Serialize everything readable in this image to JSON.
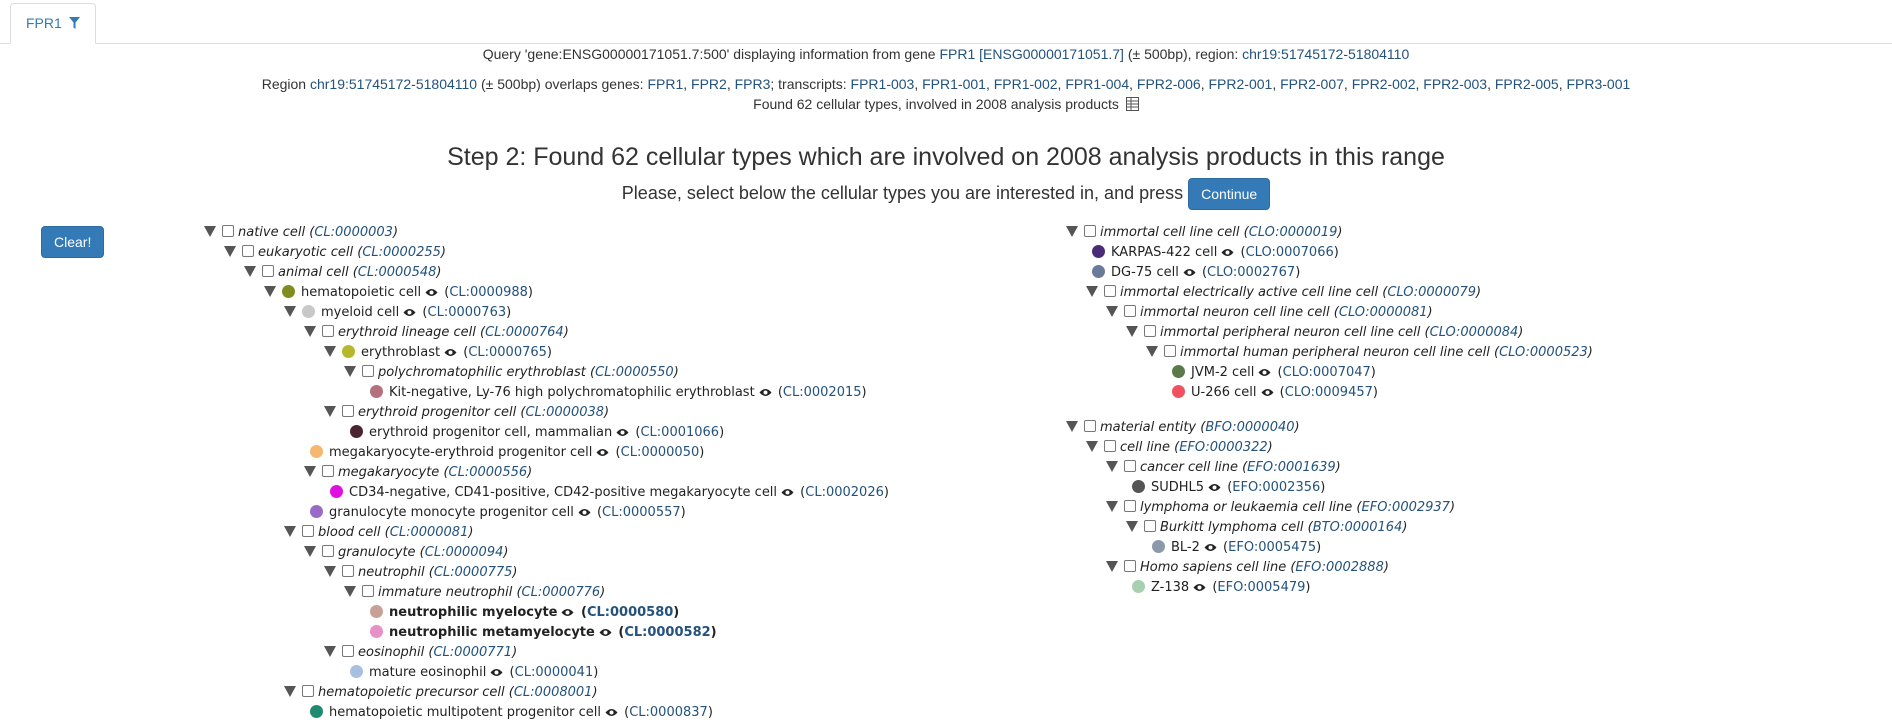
{
  "tab": {
    "label": "FPR1"
  },
  "query_line": {
    "prefix": "Query 'gene:ENSG00000171051.7:500' displaying information from gene ",
    "gene_link": "FPR1 [ENSG00000171051.7]",
    "middle": " (± 500bp), region: ",
    "region_link": "chr19:51745172-51804110"
  },
  "region_line": {
    "prefix": "Region ",
    "region_link": "chr19:51745172-51804110",
    "middle": " (± 500bp) overlaps genes: ",
    "genes": [
      "FPR1",
      "FPR2",
      "FPR3"
    ],
    "transcripts_label": "; transcripts: ",
    "transcripts": [
      "FPR1-003",
      "FPR1-001",
      "FPR1-002",
      "FPR1-004",
      "FPR2-006",
      "FPR2-001",
      "FPR2-007",
      "FPR2-002",
      "FPR2-003",
      "FPR2-005",
      "FPR3-001"
    ]
  },
  "found_line": "Found 62 cellular types, involved in 2008 analysis products",
  "step_title": "Step 2: Found 62 cellular types which are involved on 2008 analysis products in this range",
  "select_text": "Please, select below the cellular types you are interested in, and press",
  "continue_label": "Continue",
  "clear_label": "Clear!",
  "left_tree": [
    {
      "depth": 0,
      "kind": "group",
      "label": "native cell",
      "id": "CL:0000003"
    },
    {
      "depth": 1,
      "kind": "group",
      "label": "eukaryotic cell",
      "id": "CL:0000255"
    },
    {
      "depth": 2,
      "kind": "group",
      "label": "animal cell",
      "id": "CL:0000548"
    },
    {
      "depth": 3,
      "kind": "node",
      "color": "#7f8c1f",
      "label": "hematopoietic cell",
      "id": "CL:0000988"
    },
    {
      "depth": 4,
      "kind": "node",
      "color": "#c8c8c8",
      "label": "myeloid cell",
      "id": "CL:0000763"
    },
    {
      "depth": 5,
      "kind": "group",
      "label": "erythroid lineage cell",
      "id": "CL:0000764"
    },
    {
      "depth": 6,
      "kind": "node",
      "color": "#b5b82a",
      "label": "erythroblast",
      "id": "CL:0000765"
    },
    {
      "depth": 7,
      "kind": "group",
      "label": "polychromatophilic erythroblast",
      "id": "CL:0000550"
    },
    {
      "depth": 8,
      "kind": "leaf",
      "color": "#b5707e",
      "label": "Kit-negative, Ly-76 high polychromatophilic erythroblast",
      "id": "CL:0002015"
    },
    {
      "depth": 6,
      "kind": "group",
      "label": "erythroid progenitor cell",
      "id": "CL:0000038"
    },
    {
      "depth": 7,
      "kind": "leaf",
      "color": "#4a2530",
      "label": "erythroid progenitor cell, mammalian",
      "id": "CL:0001066"
    },
    {
      "depth": 5,
      "kind": "leaf",
      "color": "#f5b870",
      "label": "megakaryocyte-erythroid progenitor cell",
      "id": "CL:0000050"
    },
    {
      "depth": 5,
      "kind": "group",
      "label": "megakaryocyte",
      "id": "CL:0000556"
    },
    {
      "depth": 6,
      "kind": "leaf",
      "color": "#e010e0",
      "label": "CD34-negative, CD41-positive, CD42-positive megakaryocyte cell",
      "id": "CL:0002026"
    },
    {
      "depth": 5,
      "kind": "leaf",
      "color": "#9a6ac8",
      "label": "granulocyte monocyte progenitor cell",
      "id": "CL:0000557"
    },
    {
      "depth": 4,
      "kind": "group",
      "label": "blood cell",
      "id": "CL:0000081"
    },
    {
      "depth": 5,
      "kind": "group",
      "label": "granulocyte",
      "id": "CL:0000094"
    },
    {
      "depth": 6,
      "kind": "group",
      "label": "neutrophil",
      "id": "CL:0000775"
    },
    {
      "depth": 7,
      "kind": "group",
      "label": "immature neutrophil",
      "id": "CL:0000776"
    },
    {
      "depth": 8,
      "kind": "leaf",
      "color": "#c8a096",
      "label": "neutrophilic myelocyte",
      "id": "CL:0000580",
      "bold": true
    },
    {
      "depth": 8,
      "kind": "leaf",
      "color": "#e890c8",
      "label": "neutrophilic metamyelocyte",
      "id": "CL:0000582",
      "bold": true
    },
    {
      "depth": 6,
      "kind": "group",
      "label": "eosinophil",
      "id": "CL:0000771"
    },
    {
      "depth": 7,
      "kind": "leaf",
      "color": "#a8c0e0",
      "label": "mature eosinophil",
      "id": "CL:0000041"
    },
    {
      "depth": 4,
      "kind": "group",
      "label": "hematopoietic precursor cell",
      "id": "CL:0008001"
    },
    {
      "depth": 5,
      "kind": "leaf",
      "color": "#1f8a70",
      "label": "hematopoietic multipotent progenitor cell",
      "id": "CL:0000837"
    }
  ],
  "right_tree_a": [
    {
      "depth": 0,
      "kind": "group",
      "label": "immortal cell line cell",
      "id": "CLO:0000019"
    },
    {
      "depth": 1,
      "kind": "leaf",
      "color": "#4b2a7a",
      "label": "KARPAS-422 cell",
      "id": "CLO:0007066"
    },
    {
      "depth": 1,
      "kind": "leaf",
      "color": "#6a7a9a",
      "label": "DG-75 cell",
      "id": "CLO:0002767"
    },
    {
      "depth": 1,
      "kind": "group",
      "label": "immortal electrically active cell line cell",
      "id": "CLO:0000079"
    },
    {
      "depth": 2,
      "kind": "group",
      "label": "immortal neuron cell line cell",
      "id": "CLO:0000081"
    },
    {
      "depth": 3,
      "kind": "group",
      "label": "immortal peripheral neuron cell line cell",
      "id": "CLO:0000084"
    },
    {
      "depth": 4,
      "kind": "group",
      "label": "immortal human peripheral neuron cell line cell",
      "id": "CLO:0000523"
    },
    {
      "depth": 5,
      "kind": "leaf",
      "color": "#5a7a4a",
      "label": "JVM-2 cell",
      "id": "CLO:0007047"
    },
    {
      "depth": 5,
      "kind": "leaf",
      "color": "#f05060",
      "label": "U-266 cell",
      "id": "CLO:0009457"
    }
  ],
  "right_tree_b": [
    {
      "depth": 0,
      "kind": "group",
      "label": "material entity",
      "id": "BFO:0000040"
    },
    {
      "depth": 1,
      "kind": "group",
      "label": "cell line",
      "id": "EFO:0000322"
    },
    {
      "depth": 2,
      "kind": "group",
      "label": "cancer cell line",
      "id": "EFO:0001639"
    },
    {
      "depth": 3,
      "kind": "leaf",
      "color": "#555555",
      "label": "SUDHL5",
      "id": "EFO:0002356"
    },
    {
      "depth": 2,
      "kind": "group",
      "label": "lymphoma or leukaemia cell line",
      "id": "EFO:0002937"
    },
    {
      "depth": 3,
      "kind": "group",
      "label": "Burkitt lymphoma cell",
      "id": "BTO:0000164"
    },
    {
      "depth": 4,
      "kind": "leaf",
      "color": "#8a9aaa",
      "label": "BL-2",
      "id": "EFO:0005475"
    },
    {
      "depth": 2,
      "kind": "group",
      "label": "Homo sapiens cell line",
      "id": "EFO:0002888"
    },
    {
      "depth": 3,
      "kind": "leaf",
      "color": "#a8d0b0",
      "label": "Z-138",
      "id": "EFO:0005479"
    }
  ]
}
